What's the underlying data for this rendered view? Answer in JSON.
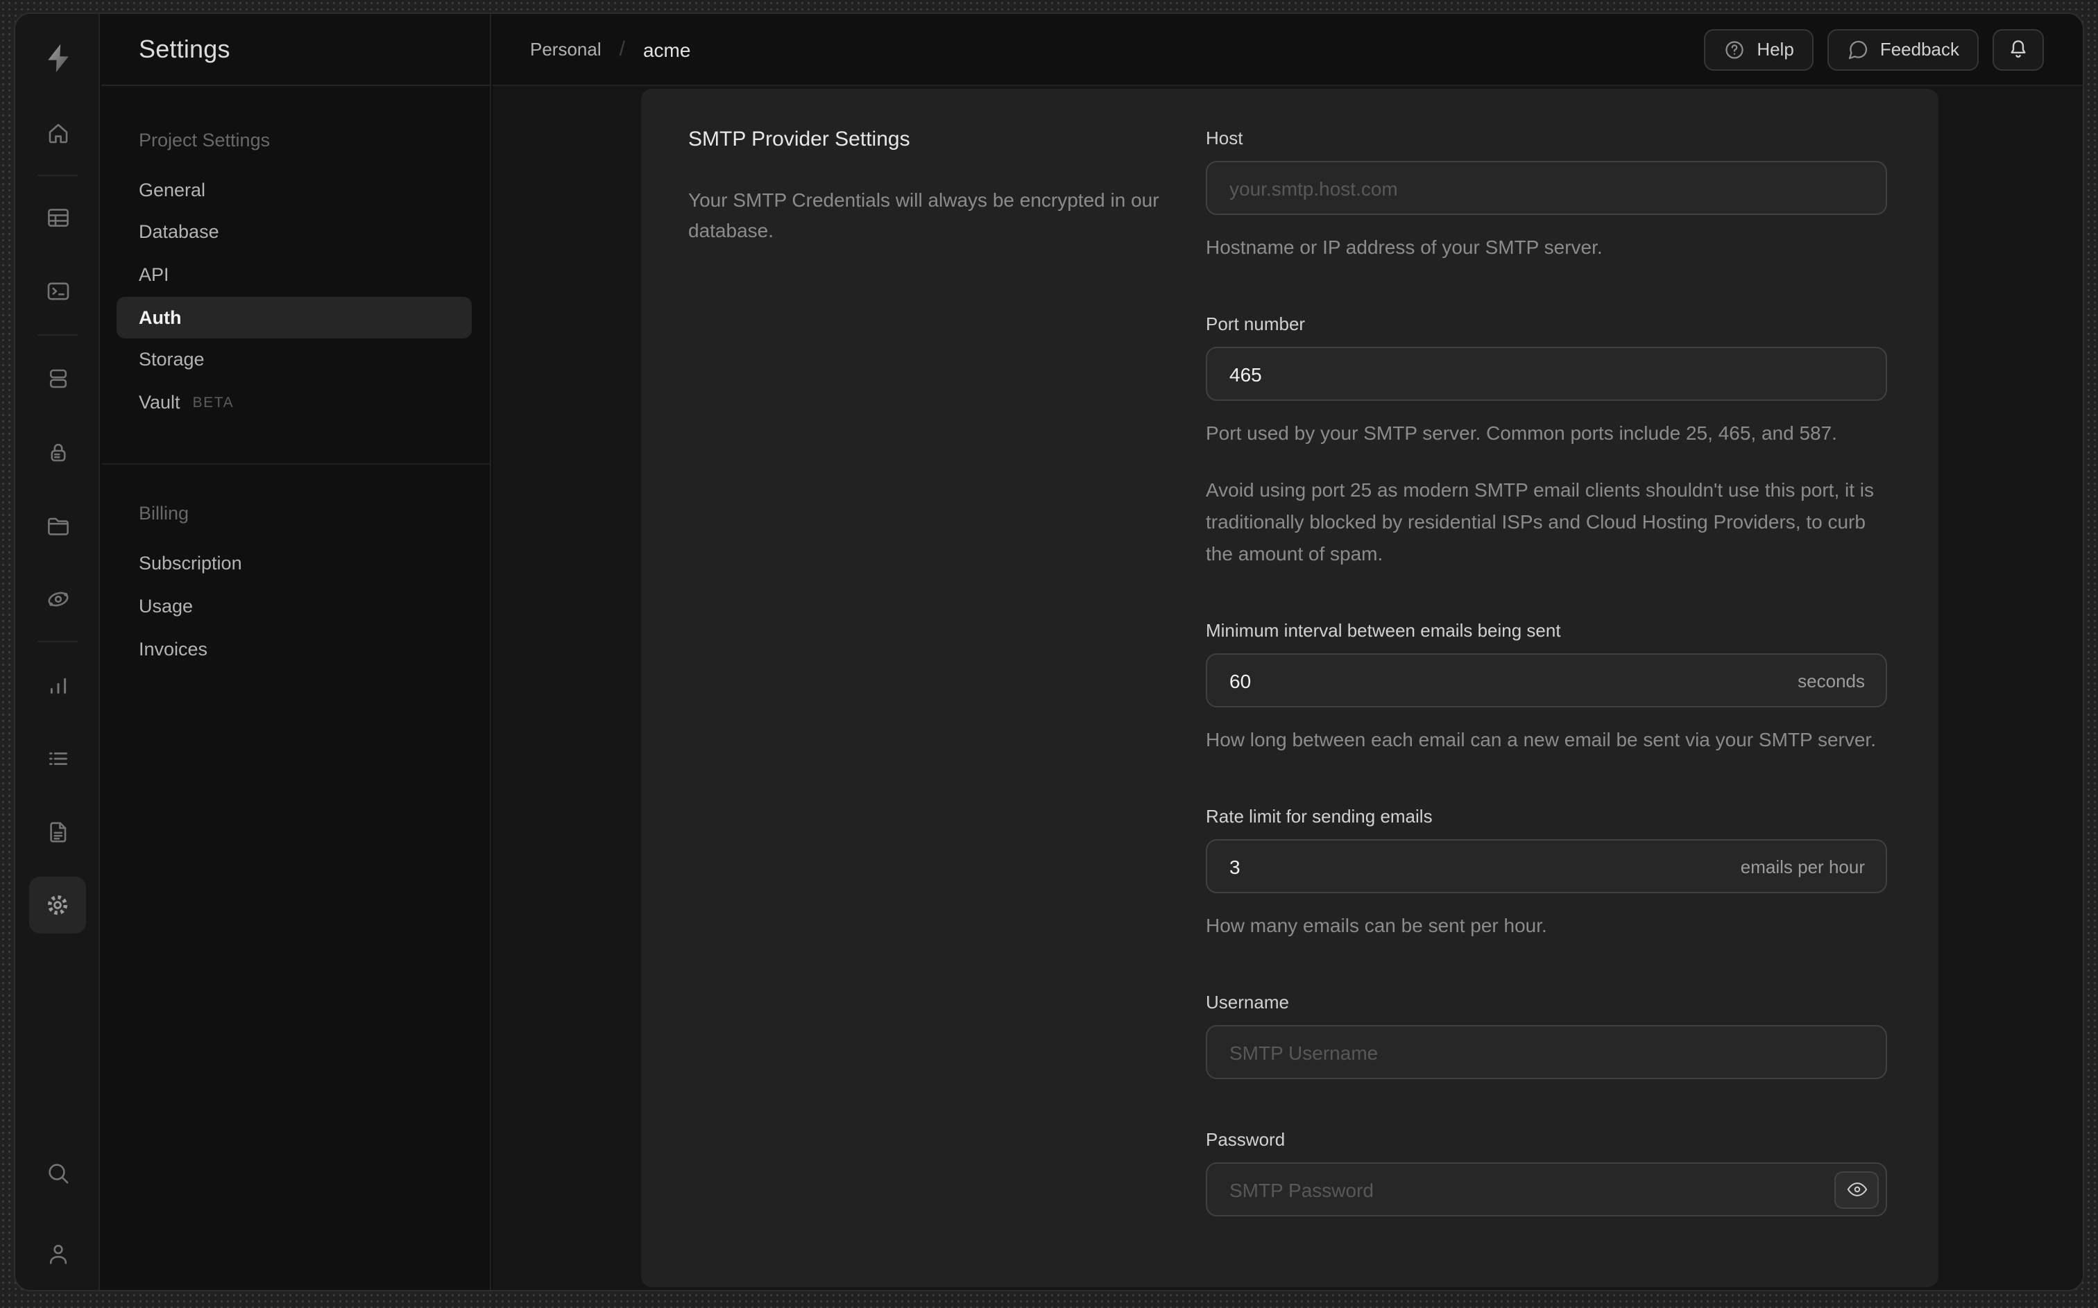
{
  "colors": {
    "window_bg": "#0f0f0f",
    "card_bg": "#222222",
    "input_bg": "#272727",
    "active_pill": "#262626",
    "desktop_bg": "#212121"
  },
  "rail_icons": [
    "supabase-logo",
    "home",
    "table-editor",
    "sql-editor",
    "database",
    "auth-lock",
    "storage-folder",
    "edge-functions",
    "reports-chart",
    "logs-list",
    "docs-file",
    "settings-gear",
    "search",
    "user"
  ],
  "sidebar": {
    "title": "Settings",
    "sections": [
      {
        "heading": "Project Settings",
        "items": [
          {
            "label": "General"
          },
          {
            "label": "Database"
          },
          {
            "label": "API"
          },
          {
            "label": "Auth",
            "active": true
          },
          {
            "label": "Storage"
          },
          {
            "label": "Vault",
            "badge": "BETA"
          }
        ]
      },
      {
        "heading": "Billing",
        "items": [
          {
            "label": "Subscription"
          },
          {
            "label": "Usage"
          },
          {
            "label": "Invoices"
          }
        ]
      }
    ]
  },
  "header": {
    "breadcrumb": {
      "org": "Personal",
      "separator": "/",
      "project": "acme"
    },
    "actions": {
      "help": "Help",
      "feedback": "Feedback",
      "bell": "notifications-bell"
    }
  },
  "content": {
    "section_title": "SMTP Provider Settings",
    "section_description": "Your SMTP Credentials will always be encrypted in our database.",
    "fields": {
      "host": {
        "label": "Host",
        "placeholder": "your.smtp.host.com",
        "help": "Hostname or IP address of your SMTP server."
      },
      "port": {
        "label": "Port number",
        "value": "465",
        "help": "Port used by your SMTP server. Common ports include 25, 465, and 587.",
        "note": "Avoid using port 25 as modern SMTP email clients shouldn't use this port, it is traditionally blocked by residential ISPs and Cloud Hosting Providers, to curb the amount of spam."
      },
      "interval": {
        "label": "Minimum interval between emails being sent",
        "value": "60",
        "suffix": "seconds",
        "help": "How long between each email can a new email be sent via your SMTP server."
      },
      "rate": {
        "label": "Rate limit for sending emails",
        "value": "3",
        "suffix": "emails per hour",
        "help": "How many emails can be sent per hour."
      },
      "username": {
        "label": "Username",
        "placeholder": "SMTP Username"
      },
      "password": {
        "label": "Password",
        "placeholder": "SMTP Password"
      }
    }
  }
}
